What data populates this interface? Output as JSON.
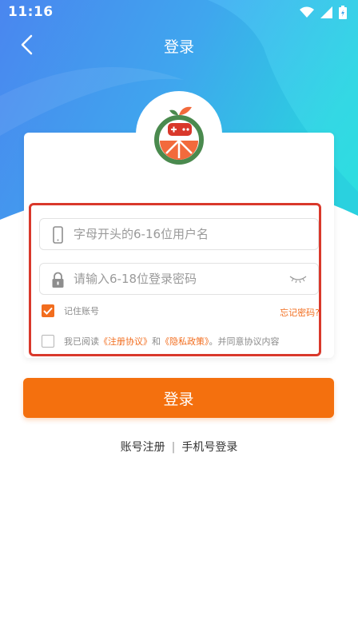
{
  "status_bar": {
    "time": "11:16"
  },
  "header": {
    "title": "登录"
  },
  "form": {
    "username_placeholder": "字母开头的6-16位用户名",
    "password_placeholder": "请输入6-18位登录密码",
    "remember_label": "记住账号",
    "remember_checked": true,
    "forgot_label": "忘记密码?",
    "agree_prefix": "我已阅读",
    "agreement_link": "《注册协议》",
    "agree_and": "和",
    "privacy_link": "《隐私政策》",
    "agree_suffix": "。并同意协议内容",
    "agree_checked": false
  },
  "login_button": "登录",
  "footer_links": {
    "register": "账号注册",
    "separator": "|",
    "phone_login": "手机号登录"
  },
  "colors": {
    "accent": "#f4700e",
    "highlight": "#d9382b",
    "hero_start": "#4a8ef0",
    "hero_end": "#22d4e0"
  }
}
